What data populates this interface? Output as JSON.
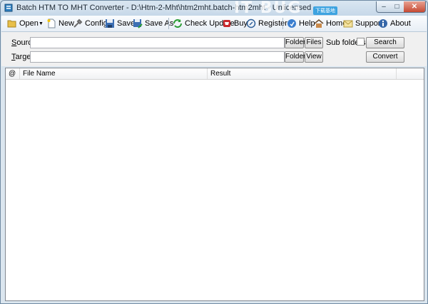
{
  "window": {
    "title": "Batch HTM TO MHT Converter - D:\\Htm-2-Mht\\htm2mht.batch-htm2mht - Unlicensed",
    "watermark": "IT BUG",
    "watermark_tag": "下载基地",
    "controls": {
      "minimize": "–",
      "maximize": "□",
      "close": "✕"
    }
  },
  "toolbar": {
    "open": "Open",
    "new": "New",
    "config": "Config",
    "save": "Save",
    "save_as": "Save As",
    "check_update": "Check Update",
    "buy": "Buy",
    "register": "Register",
    "help": "Help",
    "home": "Home",
    "support": "Support",
    "about": "About"
  },
  "form": {
    "source_label": "Source",
    "target_label": "Target",
    "source_value": "",
    "target_value": "",
    "folder_button": "Folder",
    "files_button": "Files",
    "view_button": "View",
    "subfolders_label": "Sub folders",
    "subfolders_checked": false,
    "search_button": "Search",
    "convert_button": "Convert"
  },
  "grid": {
    "columns": [
      "@",
      "File Name",
      "Result"
    ],
    "rows": []
  },
  "colors": {
    "title_bar": "#c5d7e8",
    "close_button": "#c64a33",
    "panel": "#f0f0f0",
    "accent": "#3da3e0"
  }
}
